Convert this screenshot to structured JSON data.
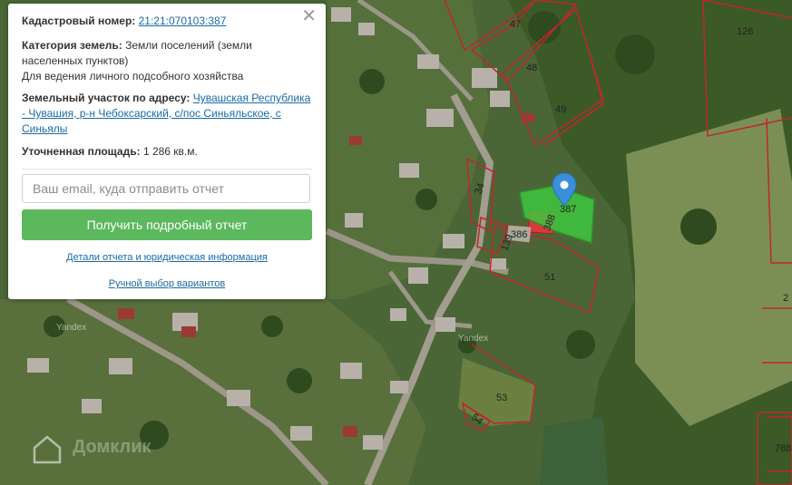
{
  "card": {
    "cadastral_label": "Кадастровый номер:",
    "cadastral_value": "21:21:070103:387",
    "category_label": "Категория земель:",
    "category_value": "Земли поселений (земли населенных пунктов)",
    "usage": "Для ведения личного подсобного хозяйства",
    "address_label": "Земельный участок по адресу:",
    "address_value": "Чувашская Республика - Чувашия, р-н Чебоксарский, с/пос Синьяльское, с Синьялы",
    "area_label": "Уточненная площадь:",
    "area_value": "1 286 кв.м.",
    "email_placeholder": "Ваш email, куда отправить отчет",
    "submit_label": "Получить подробный отчет",
    "details_link": "Детали отчета и юридическая информация",
    "manual_link": "Ручной выбор вариантов",
    "close_symbol": "✕"
  },
  "map": {
    "parcel_labels": [
      "47",
      "48",
      "49",
      "126",
      "34",
      "387",
      "386",
      "388",
      "139",
      "51",
      "53",
      "54",
      "788",
      "2"
    ],
    "yandex_label_1": "Yandex",
    "yandex_label_2": "Yandex",
    "watermark": "Домклик",
    "colors": {
      "parcel_border": "#c0262d",
      "selected_fill": "#3ec63e",
      "neighbor_fill": "#d83a3a",
      "marker": "#3b8fd9"
    }
  }
}
